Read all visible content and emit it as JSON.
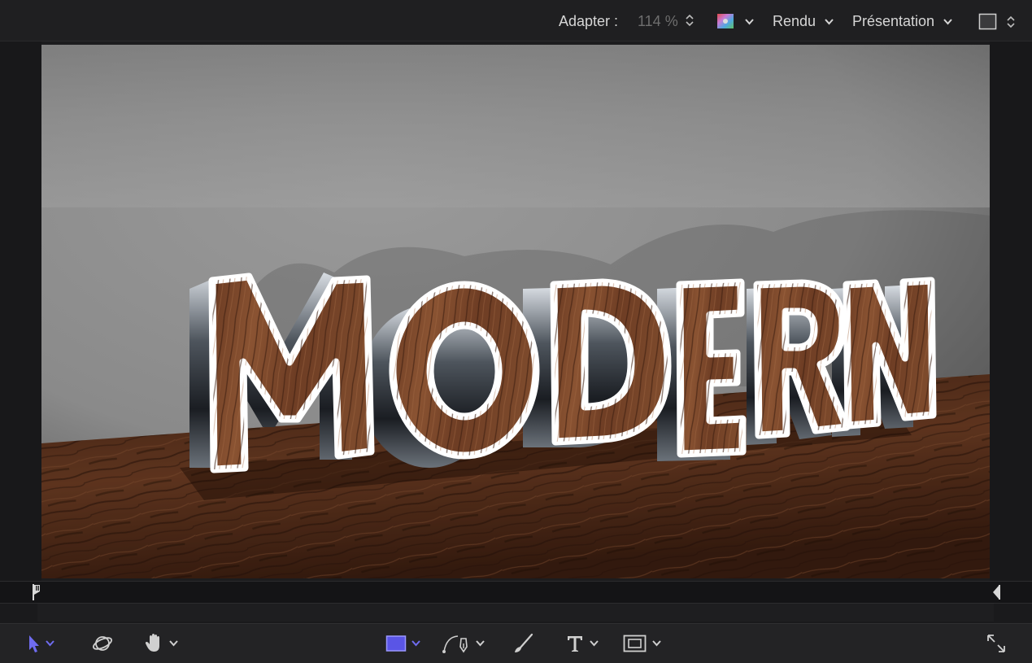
{
  "header": {
    "zoom_label": "Adapter :",
    "zoom_value": "114 %",
    "render_menu": "Rendu",
    "presentation_menu": "Présentation"
  },
  "scene": {
    "text": "MODERN"
  },
  "colors": {
    "accent": "#6f6cf0",
    "shape_tool_fill": "#5a55e6",
    "wood_dark": "#3b1f12",
    "wood_mid": "#6d3f26"
  },
  "toolbar": {
    "tools": [
      "select-transform",
      "3d-transform",
      "pan",
      "rectangle",
      "bezier-pen",
      "paint-stroke",
      "text",
      "mask"
    ]
  }
}
